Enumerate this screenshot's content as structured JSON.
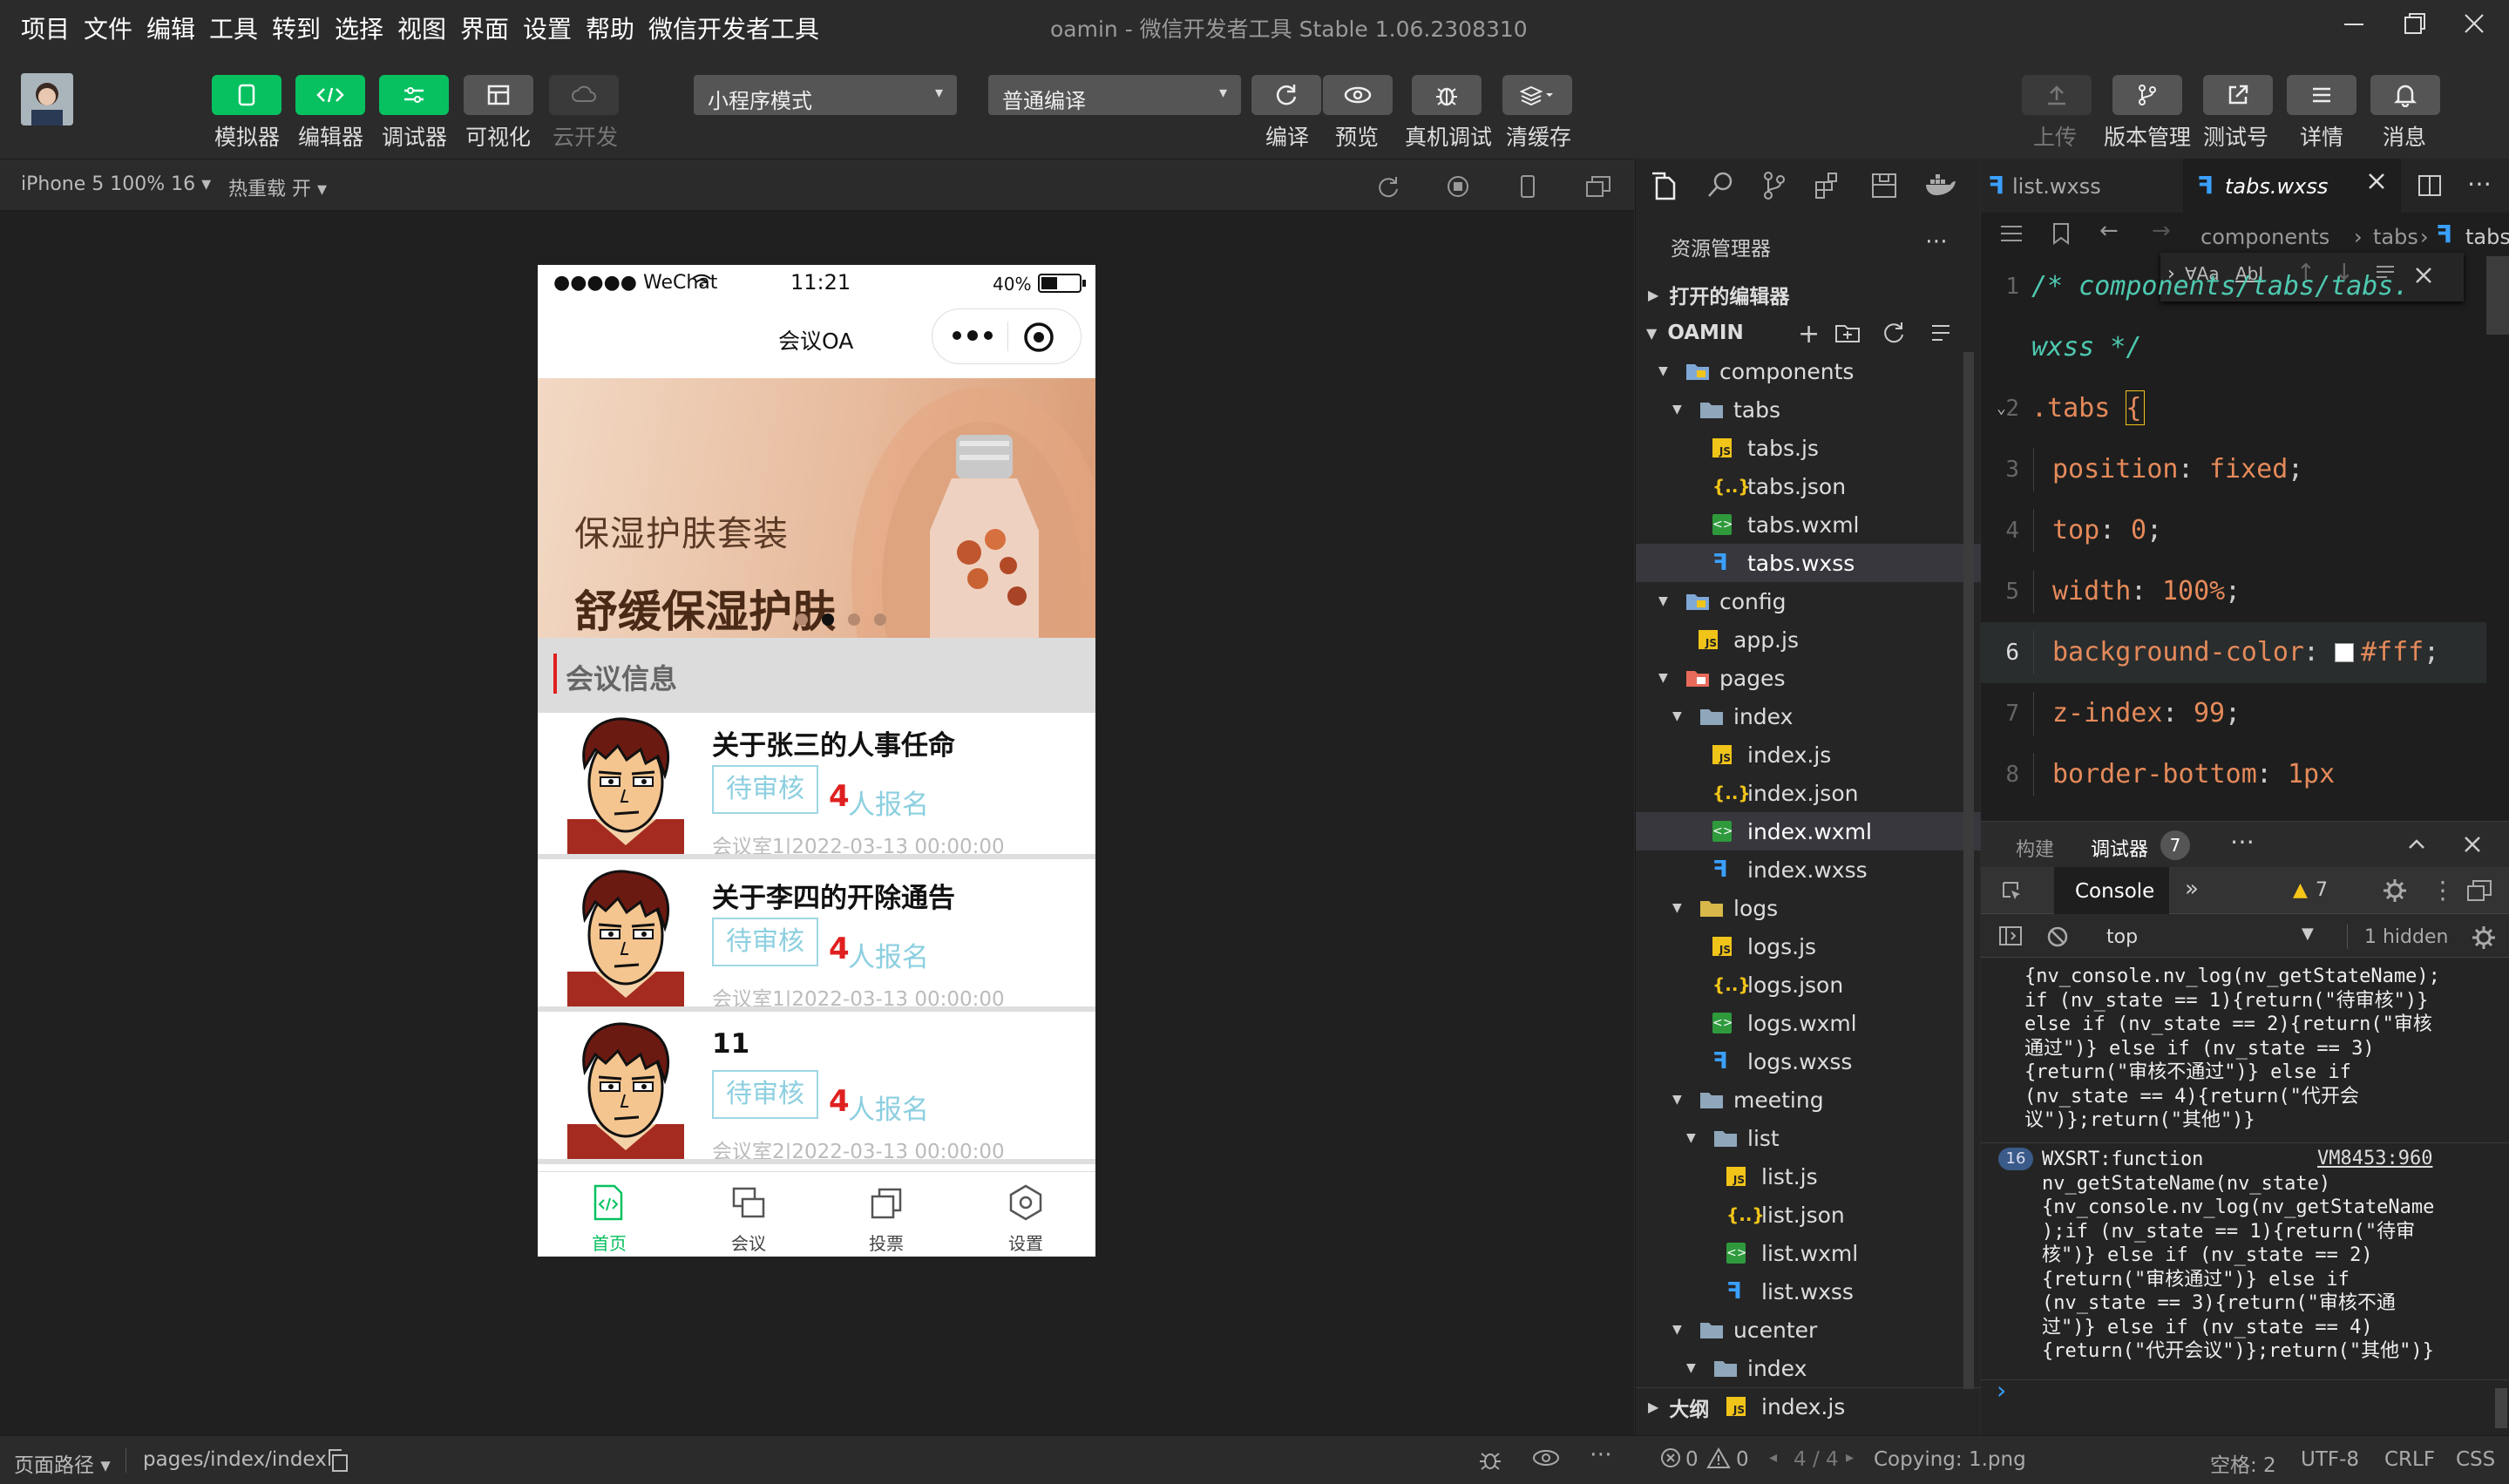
{
  "menu": [
    "项目",
    "文件",
    "编辑",
    "工具",
    "转到",
    "选择",
    "视图",
    "界面",
    "设置",
    "帮助",
    "微信开发者工具"
  ],
  "window_title": "oamin - 微信开发者工具 Stable 1.06.2308310",
  "toolbar": {
    "left_buttons": [
      "模拟器",
      "编辑器",
      "调试器",
      "可视化",
      "云开发"
    ],
    "mode_select": "小程序模式",
    "compile_select": "普通编译",
    "mid_buttons": [
      "编译",
      "预览",
      "真机调试",
      "清缓存"
    ],
    "right_buttons": [
      "上传",
      "版本管理",
      "测试号",
      "详情",
      "消息"
    ]
  },
  "subbar": {
    "device": "iPhone 5 100% 16 ▾",
    "hot_reload": "热重载 开 ▾"
  },
  "phone": {
    "status_signal": "●●●●● WeChat",
    "status_time": "11:21",
    "status_battery": "40%",
    "nav_title": "会议OA",
    "banner_line1": "保湿护肤套装",
    "banner_line2": "舒缓保湿护肤",
    "section_title": "会议信息",
    "items": [
      {
        "title": "关于张三的人事任命",
        "state": "待审核",
        "count": "4",
        "count_suffix": "人报名",
        "meta": "会议室1|2022-03-13 00:00:00"
      },
      {
        "title": "关于李四的开除通告",
        "state": "待审核",
        "count": "4",
        "count_suffix": "人报名",
        "meta": "会议室1|2022-03-13 00:00:00"
      },
      {
        "title": "11",
        "state": "待审核",
        "count": "4",
        "count_suffix": "人报名",
        "meta": "会议室2|2022-03-13 00:00:00"
      }
    ],
    "tabs": [
      "首页",
      "会议",
      "投票",
      "设置"
    ]
  },
  "explorer": {
    "header": "资源管理器",
    "open_editors": "打开的编辑器",
    "root": "OAMIN",
    "outline": "大纲",
    "tree": [
      {
        "name": "components",
        "depth": 1,
        "type": "folder-special",
        "open": true
      },
      {
        "name": "tabs",
        "depth": 2,
        "type": "folder",
        "open": true
      },
      {
        "name": "tabs.js",
        "depth": 3,
        "type": "js"
      },
      {
        "name": "tabs.json",
        "depth": 3,
        "type": "json"
      },
      {
        "name": "tabs.wxml",
        "depth": 3,
        "type": "wxml"
      },
      {
        "name": "tabs.wxss",
        "depth": 3,
        "type": "wxss",
        "hl": true
      },
      {
        "name": "config",
        "depth": 1,
        "type": "folder-special",
        "open": true
      },
      {
        "name": "app.js",
        "depth": 2,
        "type": "js"
      },
      {
        "name": "pages",
        "depth": 1,
        "type": "folder-pages",
        "open": true
      },
      {
        "name": "index",
        "depth": 2,
        "type": "folder",
        "open": true
      },
      {
        "name": "index.js",
        "depth": 3,
        "type": "js"
      },
      {
        "name": "index.json",
        "depth": 3,
        "type": "json"
      },
      {
        "name": "index.wxml",
        "depth": 3,
        "type": "wxml",
        "hl": true
      },
      {
        "name": "index.wxss",
        "depth": 3,
        "type": "wxss"
      },
      {
        "name": "logs",
        "depth": 2,
        "type": "folder-yellow",
        "open": true
      },
      {
        "name": "logs.js",
        "depth": 3,
        "type": "js"
      },
      {
        "name": "logs.json",
        "depth": 3,
        "type": "json"
      },
      {
        "name": "logs.wxml",
        "depth": 3,
        "type": "wxml"
      },
      {
        "name": "logs.wxss",
        "depth": 3,
        "type": "wxss"
      },
      {
        "name": "meeting",
        "depth": 2,
        "type": "folder",
        "open": true
      },
      {
        "name": "list",
        "depth": 3,
        "type": "folder",
        "open": true
      },
      {
        "name": "list.js",
        "depth": 4,
        "type": "js"
      },
      {
        "name": "list.json",
        "depth": 4,
        "type": "json"
      },
      {
        "name": "list.wxml",
        "depth": 4,
        "type": "wxml"
      },
      {
        "name": "list.wxss",
        "depth": 4,
        "type": "wxss"
      },
      {
        "name": "ucenter",
        "depth": 2,
        "type": "folder",
        "open": true
      },
      {
        "name": "index",
        "depth": 3,
        "type": "folder",
        "open": true
      },
      {
        "name": "index.js",
        "depth": 4,
        "type": "js"
      }
    ]
  },
  "editor": {
    "tabs": [
      "list.wxss",
      "tabs.wxss"
    ],
    "breadcrumb": [
      "components",
      "tabs",
      "tabs"
    ],
    "lines": [
      {
        "no": "1",
        "text": "/* components/tabs/tabs."
      },
      {
        "no": "",
        "text": "wxss */"
      },
      {
        "no": "2",
        "text": ".tabs {"
      },
      {
        "no": "3",
        "prop": "position",
        "val": "fixed"
      },
      {
        "no": "4",
        "prop": "top",
        "val": "0"
      },
      {
        "no": "5",
        "prop": "width",
        "val": "100%"
      },
      {
        "no": "6",
        "prop": "background-color",
        "val": "#fff",
        "swatch": "#ffffff"
      },
      {
        "no": "7",
        "prop": "z-index",
        "val": "99"
      },
      {
        "no": "8",
        "prop": "border-bottom",
        "val": "1px"
      }
    ]
  },
  "console": {
    "tabs": [
      "构建",
      "调试器"
    ],
    "badge": "7",
    "console_tab": "Console",
    "warn_count": "7",
    "context": "top",
    "hidden": "1 hidden",
    "log1": "{nv_console.nv_log(nv_getStateName);\nif (nv_state == 1){return(\"待审核\")}\nelse if (nv_state == 2){return(\"审核\n通过\")} else if (nv_state == 3)\n{return(\"审核不通过\")} else if\n(nv_state == 4){return(\"代开会\n议\")};return(\"其他\")}",
    "log2_count": "16",
    "log2_link": "VM8453:960",
    "log2": "WXSRT:function\nnv_getStateName(nv_state)\n{nv_console.nv_log(nv_getStateName\n);if (nv_state == 1){return(\"待审\n核\")} else if (nv_state == 2)\n{return(\"审核通过\")} else if\n(nv_state == 3){return(\"审核不通\n过\")} else if (nv_state == 4)\n{return(\"代开会议\")};return(\"其他\")}"
  },
  "status": {
    "page_path_label": "页面路径 ▾",
    "page_path": "pages/index/index",
    "errors": "0",
    "warnings": "0",
    "match": "4 / 4",
    "copying": "Copying: 1.png",
    "spaces": "空格: 2",
    "encoding": "UTF-8",
    "eol": "CRLF",
    "lang": "CSS"
  },
  "colors": {
    "accent_green": "#07c160",
    "tab_active": "#07c160",
    "count_red": "#e02020",
    "state_blue": "#8ccfe0"
  }
}
